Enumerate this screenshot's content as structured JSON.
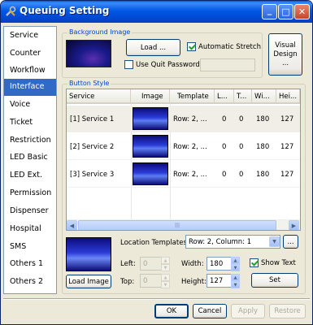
{
  "window": {
    "title": "Queuing Setting",
    "minimize": "_",
    "maximize": "□",
    "close": "✕"
  },
  "nav": {
    "items": [
      {
        "label": "Service"
      },
      {
        "label": "Counter"
      },
      {
        "label": "Workflow"
      },
      {
        "label": "Interface",
        "selected": true
      },
      {
        "label": "Voice"
      },
      {
        "label": "Ticket"
      },
      {
        "label": "Restriction"
      },
      {
        "label": "LED Basic"
      },
      {
        "label": "LED Ext."
      },
      {
        "label": "Permission"
      },
      {
        "label": "Dispenser"
      },
      {
        "label": "Hospital"
      },
      {
        "label": "SMS"
      },
      {
        "label": "Others 1"
      },
      {
        "label": "Others 2"
      }
    ]
  },
  "background_image": {
    "legend": "Background Image",
    "load_label": "Load ...",
    "auto_stretch_label": "Automatic Stretch",
    "auto_stretch_checked": true,
    "quit_password_label": "Use Quit Password:",
    "quit_password_checked": false,
    "quit_password_value": ""
  },
  "visual_design_label": "Visual\nDesign\n...",
  "button_style": {
    "legend": "Button Style",
    "columns": [
      "Service",
      "Image",
      "Template",
      "L...",
      "T...",
      "Wi...",
      "Hei..."
    ],
    "rows": [
      {
        "service": "[1] Service 1",
        "template": "Row: 2, ...",
        "l": "0",
        "t": "0",
        "w": "180",
        "h": "127",
        "selected": true
      },
      {
        "service": "[2] Service 2",
        "template": "Row: 2, ...",
        "l": "0",
        "t": "0",
        "w": "180",
        "h": "127"
      },
      {
        "service": "[3] Service 3",
        "template": "Row: 2, ...",
        "l": "0",
        "t": "0",
        "w": "180",
        "h": "127"
      }
    ],
    "load_image_label": "Load Image",
    "location_templates_label": "Location Templates:",
    "location_template_value": "Row: 2, Column: 1",
    "ellipsis_label": "...",
    "left_label": "Left:",
    "left_value": "0",
    "top_label": "Top:",
    "top_value": "0",
    "width_label": "Width:",
    "width_value": "180",
    "height_label": "Height:",
    "height_value": "127",
    "show_text_label": "Show Text",
    "show_text_checked": true,
    "set_label": "Set"
  },
  "footer": {
    "ok_label": "OK",
    "cancel_label": "Cancel",
    "apply_label": "Apply",
    "restore_label": "Restore"
  },
  "colors": {
    "title_bar": "#0058e6",
    "nav_selected": "#316ac5",
    "legend_text": "#0046d5",
    "window_bg": "#ece9d8"
  }
}
